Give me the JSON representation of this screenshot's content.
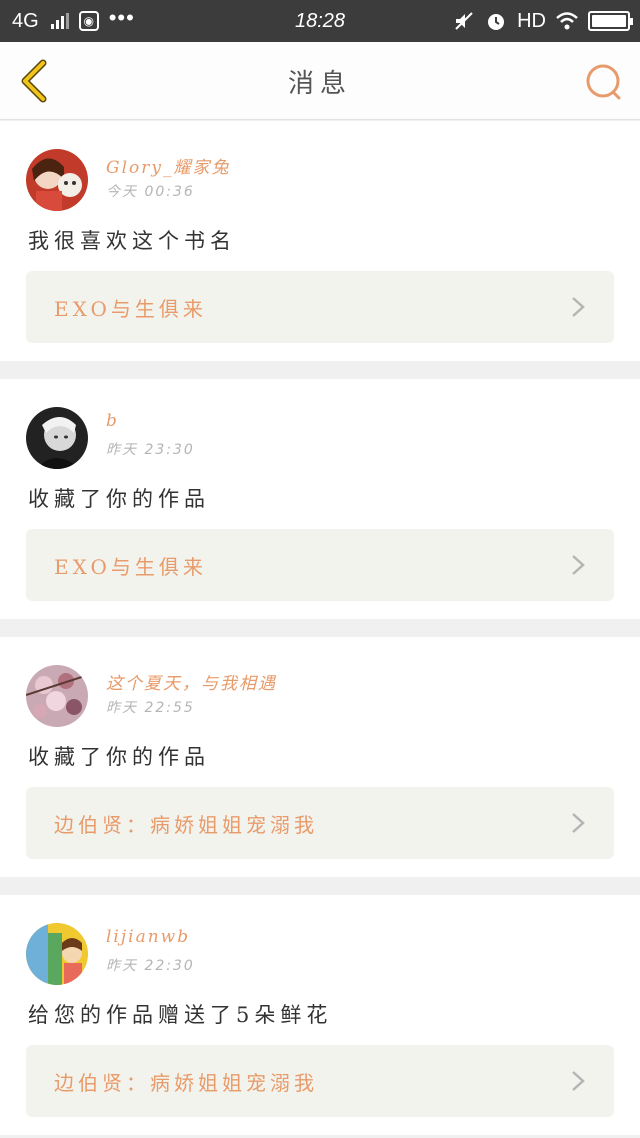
{
  "status_bar": {
    "network": "4G",
    "time": "18:28",
    "hd": "HD"
  },
  "nav": {
    "title": "消息",
    "back_icon": "chevron-left-icon",
    "search_icon": "search-icon"
  },
  "colors": {
    "accent": "#e89b6a",
    "back_arrow": "#f2c318",
    "card_link_bg": "#f3f3ee"
  },
  "messages": [
    {
      "username": "Glory_耀家兔",
      "timestamp": "今天  00:36",
      "text": "我很喜欢这个书名",
      "work_title": "EXO与生俱来"
    },
    {
      "username": "b",
      "timestamp": "昨天  23:30",
      "text": "收藏了你的作品",
      "work_title": "EXO与生俱来"
    },
    {
      "username": "这个夏天，与我相遇",
      "timestamp": "昨天  22:55",
      "text": "收藏了你的作品",
      "work_title": "边伯贤：病娇姐姐宠溺我"
    },
    {
      "username": "lijianwb",
      "timestamp": "昨天  22:30",
      "text": "给您的作品赠送了5朵鲜花",
      "work_title": "边伯贤：病娇姐姐宠溺我"
    }
  ]
}
